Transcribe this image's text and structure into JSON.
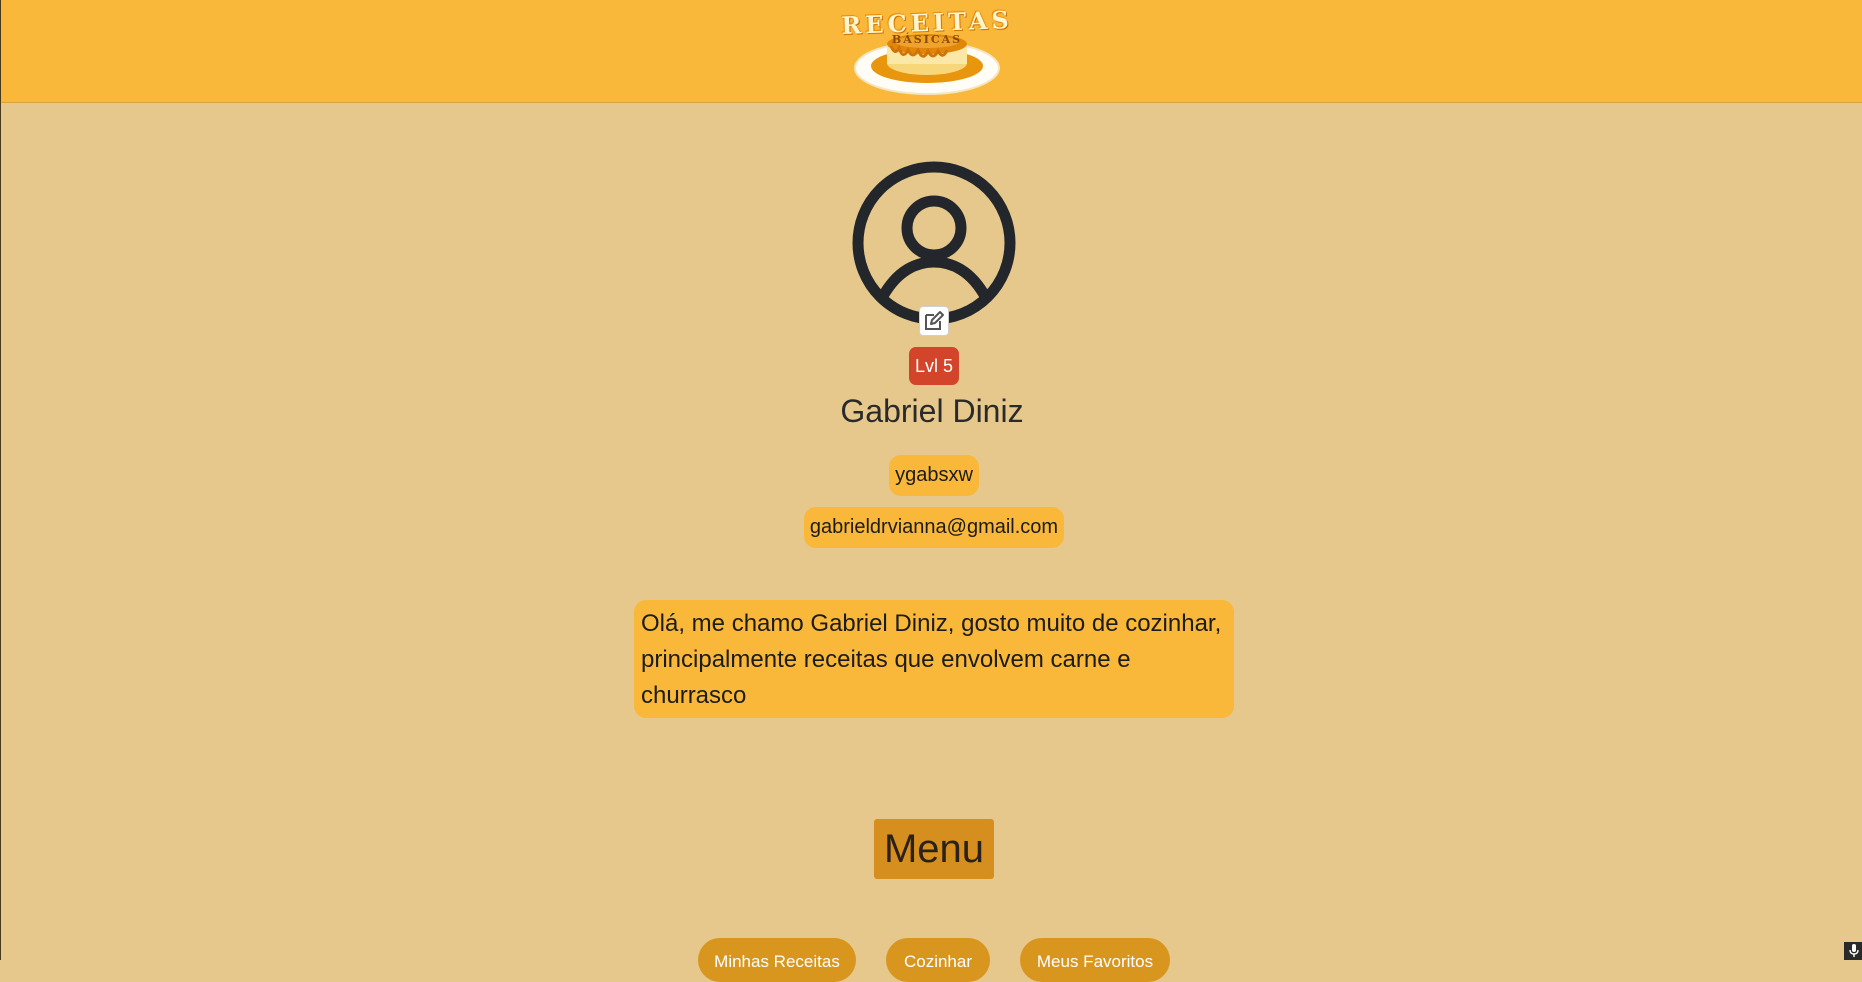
{
  "header": {
    "logo_title": "RECEITAS",
    "logo_subtitle": "BÁSICAS",
    "logo_icon": "pudding-plate-logo"
  },
  "profile": {
    "avatar_icon": "user-circle-icon",
    "edit_icon": "edit-icon",
    "level_label": "Lvl 5",
    "name": "Gabriel Diniz",
    "username": "ygabsxw",
    "email": "gabrieldrvianna@gmail.com",
    "bio": "Olá, me chamo Gabriel Diniz, gosto muito de cozinhar, principalmente receitas que envolvem carne e churrasco"
  },
  "menu": {
    "title": "Menu",
    "buttons": [
      {
        "label": "Minhas Receitas"
      },
      {
        "label": "Cozinhar"
      },
      {
        "label": "Meus Favoritos"
      }
    ]
  },
  "colors": {
    "header_bg": "#f9b83a",
    "page_bg": "#e6c88c",
    "pill_bg": "#f9b83a",
    "level_badge": "#d2452a",
    "menu_title_bg": "#d68e1f",
    "menu_button_bg": "#d9961f"
  },
  "mic_icon": "microphone-icon"
}
